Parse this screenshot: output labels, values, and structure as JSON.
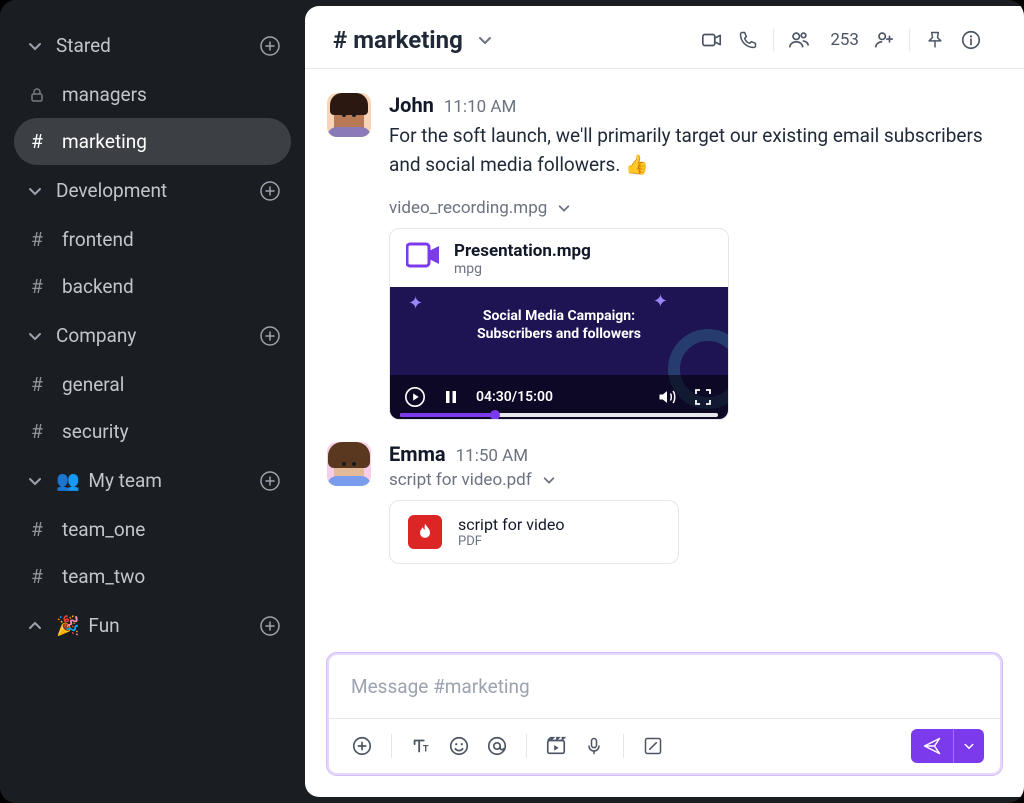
{
  "sidebar": {
    "sections": [
      {
        "title": "Stared",
        "collapsed": false,
        "plus": true,
        "items": [
          {
            "name": "managers",
            "icon": "lock"
          },
          {
            "name": "marketing",
            "icon": "hash",
            "active": true
          }
        ]
      },
      {
        "title": "Development",
        "collapsed": false,
        "plus": true,
        "items": [
          {
            "name": "frontend",
            "icon": "hash"
          },
          {
            "name": "backend",
            "icon": "hash"
          }
        ]
      },
      {
        "title": "Company",
        "collapsed": false,
        "plus": true,
        "items": [
          {
            "name": "general",
            "icon": "hash"
          },
          {
            "name": "security",
            "icon": "hash"
          }
        ]
      },
      {
        "title": "My team",
        "emoji": "👥",
        "collapsed": false,
        "plus": true,
        "items": [
          {
            "name": "team_one",
            "icon": "hash"
          },
          {
            "name": "team_two",
            "icon": "hash"
          }
        ]
      },
      {
        "title": "Fun",
        "emoji": "🎉",
        "collapsed": true,
        "plus": true,
        "items": []
      }
    ]
  },
  "header": {
    "hash": "#",
    "channel": "marketing",
    "member_count": "253"
  },
  "messages": [
    {
      "author": "John",
      "time": "11:10 AM",
      "text": "For the soft launch, we'll primarily target our existing email subscribers and social media followers. ",
      "emoji": "👍",
      "video_attachment": {
        "label": "video_recording.mpg",
        "title": "Presentation.mpg",
        "ext": "mpg",
        "overlay_title_1": "Social Media Campaign:",
        "overlay_title_2": "Subscribers and followers",
        "time": "04:30/15:00"
      }
    },
    {
      "author": "Emma",
      "time": "11:50 AM",
      "pdf_attachment": {
        "label": "script for video.pdf",
        "title": "script for video",
        "ext": "PDF"
      }
    }
  ],
  "composer": {
    "placeholder": "Message #marketing"
  }
}
